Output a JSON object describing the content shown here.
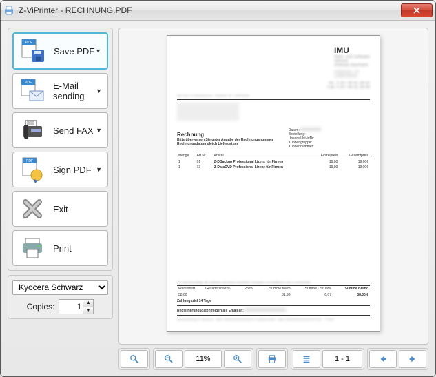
{
  "window": {
    "title": "Z-ViPrinter - RECHNUNG.PDF"
  },
  "actions": {
    "save_pdf": "Save PDF",
    "email": "E-Mail sending",
    "fax": "Send FAX",
    "sign": "Sign PDF",
    "exit": "Exit",
    "print": "Print"
  },
  "printer": {
    "selected": "Kyocera Schwarz",
    "copies_label": "Copies:",
    "copies_value": "1"
  },
  "toolbar": {
    "zoom_pct": "11%",
    "page_indicator": "1 - 1"
  },
  "document": {
    "company": "IMU",
    "company_sub1": "Hard- und Software",
    "company_sub2": "Service",
    "company_name": "Andreas Baumann",
    "tel": "Tel.: 0 30 / 40 91 39 50",
    "fax": "Fax: 0 30 / 40 91 39 09",
    "sender_line": "IMU Hard- & Softwareservice · Plettstraß. 38 · 13469 Berlin",
    "heading": "Rechnung",
    "subhead1": "Bitte überweisen Sie unter Angabe der Rechnungsnummer",
    "subhead2": "Rechnungsdatum gleich Lieferdatum",
    "meta_labels": {
      "datum": "Datum:",
      "bestellung": "Bestellung:",
      "ustid": "Unsere Ust-IdNr:",
      "kgruppe": "Kundengruppe:",
      "knummer": "Kundennummer:"
    },
    "columns": {
      "menge": "Menge",
      "artnr": "Art.Nr.",
      "artikel": "Artikel",
      "einzel": "Einzelpreis",
      "gesamt": "Gesamtpreis"
    },
    "items": [
      {
        "menge": "1",
        "artnr": "01",
        "artikel": "Z-DBackup Professional Lizenz für Firmen",
        "einzel": "19,00",
        "gesamt": "19,00€"
      },
      {
        "menge": "1",
        "artnr": "13",
        "artikel": "Z-DataDVD Professional Lizenz für Firmen",
        "einzel": "19,00",
        "gesamt": "19,00€"
      }
    ],
    "footer_note": "Sie sind berechtigt, die Software auf einem einzelnen Computer zu installieren und zu verwenden.",
    "totals_labels": {
      "warenwert": "Warenwert",
      "rabatt": "Gesamtrabatt %",
      "porto": "Porto",
      "netto": "Summe Netto",
      "ust": "Summe USt 19%",
      "brutto": "Summe Brutto"
    },
    "totals": {
      "warenwert": "38,00",
      "rabatt": "",
      "porto": "",
      "netto": "31,93",
      "ust": "6,07",
      "brutto": "38,00 €"
    },
    "zahlungsziel": "Zahlungsziel 14 Tage",
    "regline": "Registrierungsdaten folgen als Email an:",
    "bankline": "Bankverbindung: A. Baumann · IBAN: DE981001001001001071 Postbank Berlin · IBAN: DE981001001001001071010 · ****ADC"
  }
}
